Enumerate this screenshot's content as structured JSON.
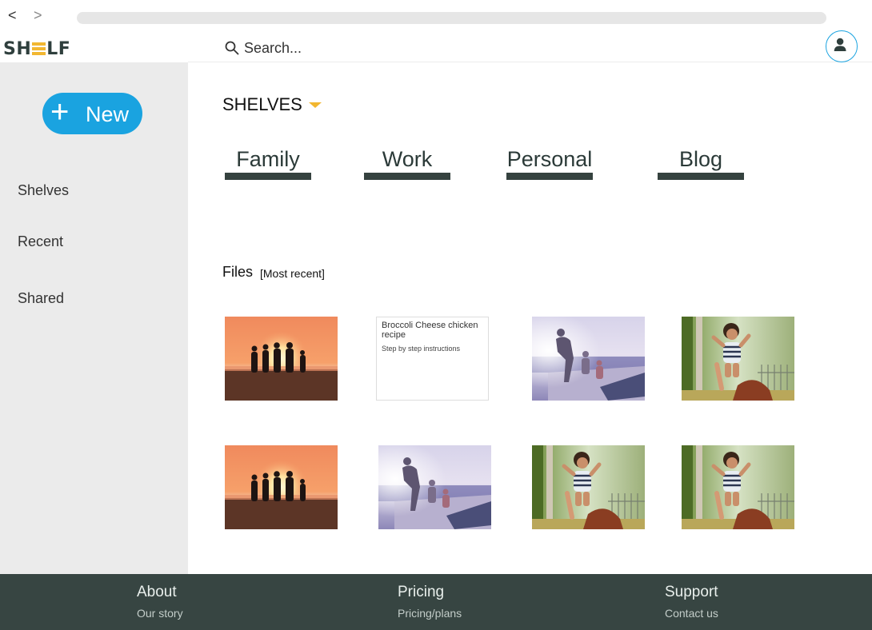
{
  "browser": {
    "back_glyph": "<",
    "forward_glyph": ">"
  },
  "brand": {
    "logo_text_left": "SH",
    "logo_text_right": "LF",
    "logo_letter": "E",
    "accent": "#f2b731",
    "primary": "#1aa3e0",
    "dark": "#374542"
  },
  "sidebar": {
    "new_button_icon": "+",
    "new_button_label": "New",
    "items": [
      {
        "label": "Shelves"
      },
      {
        "label": "Recent"
      },
      {
        "label": "Shared"
      }
    ]
  },
  "topbar": {
    "search_placeholder": "Search...",
    "search_icon": "search-icon",
    "avatar_icon": "user-icon"
  },
  "shelves": {
    "title": "SHELVES",
    "tabs": [
      {
        "label": "Family"
      },
      {
        "label": "Work"
      },
      {
        "label": "Personal"
      },
      {
        "label": "Blog"
      }
    ]
  },
  "files": {
    "title": "Files",
    "subtitle": "[Most recent]",
    "items": [
      {
        "kind": "image",
        "scene": "sunset-family"
      },
      {
        "kind": "document",
        "title": "Broccoli Cheese chicken recipe",
        "subtitle": "Step by step instructions"
      },
      {
        "kind": "image",
        "scene": "boat-family"
      },
      {
        "kind": "image",
        "scene": "child-play"
      },
      {
        "kind": "image",
        "scene": "sunset-family"
      },
      {
        "kind": "image",
        "scene": "boat-family"
      },
      {
        "kind": "image",
        "scene": "child-play"
      },
      {
        "kind": "image",
        "scene": "child-play"
      }
    ]
  },
  "footer": {
    "columns": [
      {
        "heading": "About",
        "link": "Our story"
      },
      {
        "heading": "Pricing",
        "link": "Pricing/plans"
      },
      {
        "heading": "Support",
        "link": "Contact us"
      }
    ]
  }
}
